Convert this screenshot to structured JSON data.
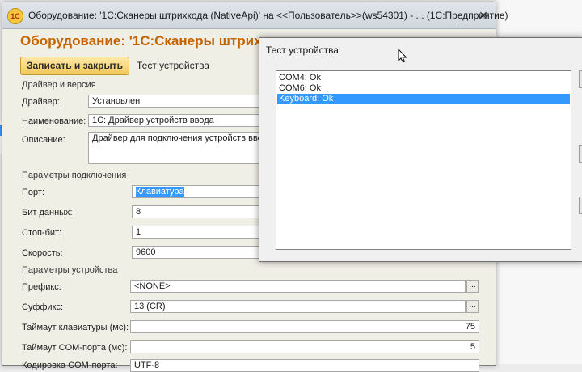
{
  "window": {
    "title": "Оборудование: '1С:Сканеры штрихкода (NativeApi)' на <<Пользователь>>(ws54301) - ...  (1С:Предприятие)",
    "icon_label": "1С",
    "close_glyph": "✕"
  },
  "form": {
    "heading": "Оборудование: '1С:Сканеры штрих",
    "save_close_label": "Записать и закрыть",
    "test_device_label": "Тест устройства"
  },
  "sections": {
    "driver": "Драйвер и версия",
    "connection": "Параметры подключения",
    "device": "Параметры устройства"
  },
  "fields": {
    "driver": {
      "label": "Драйвер:",
      "value": "Установлен"
    },
    "name": {
      "label": "Наименование:",
      "value": "1С: Драйвер устройств ввода"
    },
    "description": {
      "label": "Описание:",
      "value": "Драйвер для подключения устройств вво"
    },
    "port": {
      "label": "Порт:",
      "value": "Клавиатура"
    },
    "data_bits": {
      "label": "Бит данных:",
      "value": "8"
    },
    "stop_bit": {
      "label": "Стоп-бит:",
      "value": "1"
    },
    "speed": {
      "label": "Скорость:",
      "value": "9600"
    },
    "prefix": {
      "label": "Префикс:",
      "value": "<NONE>"
    },
    "suffix": {
      "label": "Суффикс:",
      "value": "13 (CR)"
    },
    "kb_timeout": {
      "label": "Таймаут клавиатуры (мс):",
      "value": "75"
    },
    "com_timeout": {
      "label": "Таймаут COM-порта (мс):",
      "value": "5"
    },
    "encoding": {
      "label": "Кодировка COM-порта:",
      "value": "UTF-8"
    }
  },
  "dialog": {
    "title": "Тест устройства",
    "items": [
      "COM4: Ok",
      "COM6: Ok",
      "Keyboard: Ok"
    ],
    "selected_index": 2
  },
  "colors": {
    "heading": "#c46300",
    "selection": "#3399ff"
  }
}
